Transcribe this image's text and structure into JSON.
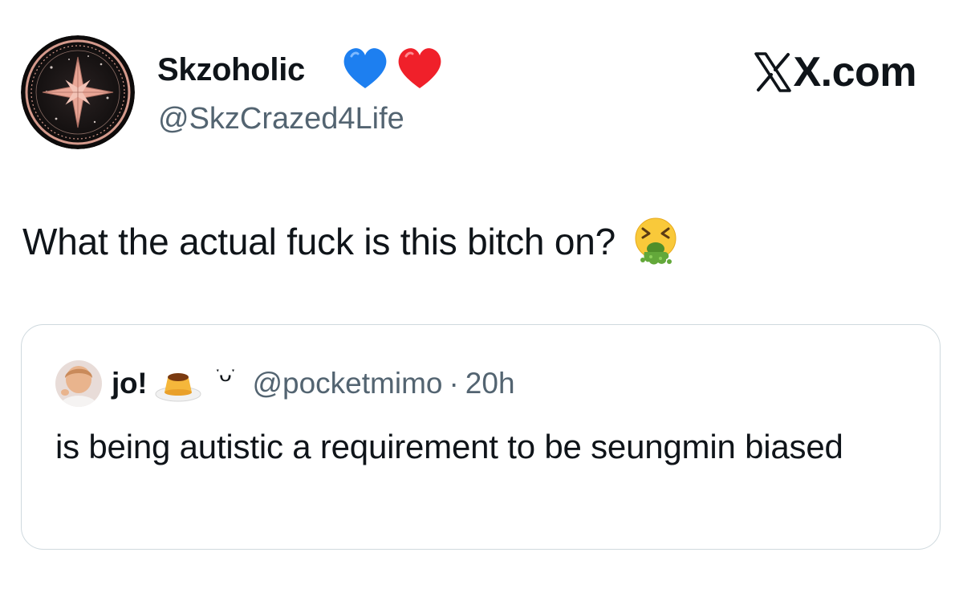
{
  "tweet": {
    "author": {
      "display_name": "Skzoholic",
      "name_emojis": [
        "blue-heart",
        "red-heart"
      ],
      "handle": "@SkzCrazed4Life",
      "avatar": "compass-star-avatar"
    },
    "source_label": "X.com",
    "text": "What the actual fuck is this bitch on?",
    "text_emoji": "vomiting-face",
    "quoted": {
      "display_name": "jo!",
      "name_emoji": "custard-pudding",
      "name_kaomoji": "ˑᴗˑ",
      "handle": "@pocketmimo",
      "separator": "·",
      "time": "20h",
      "text": "is being autistic a requirement to be seungmin biased"
    }
  },
  "colors": {
    "text_primary": "#0f1419",
    "text_secondary": "#536471",
    "card_border": "#cfd9de",
    "blue_heart": "#1d7ff0",
    "red_heart": "#f0202a",
    "vomit_green": "#63a83a"
  }
}
